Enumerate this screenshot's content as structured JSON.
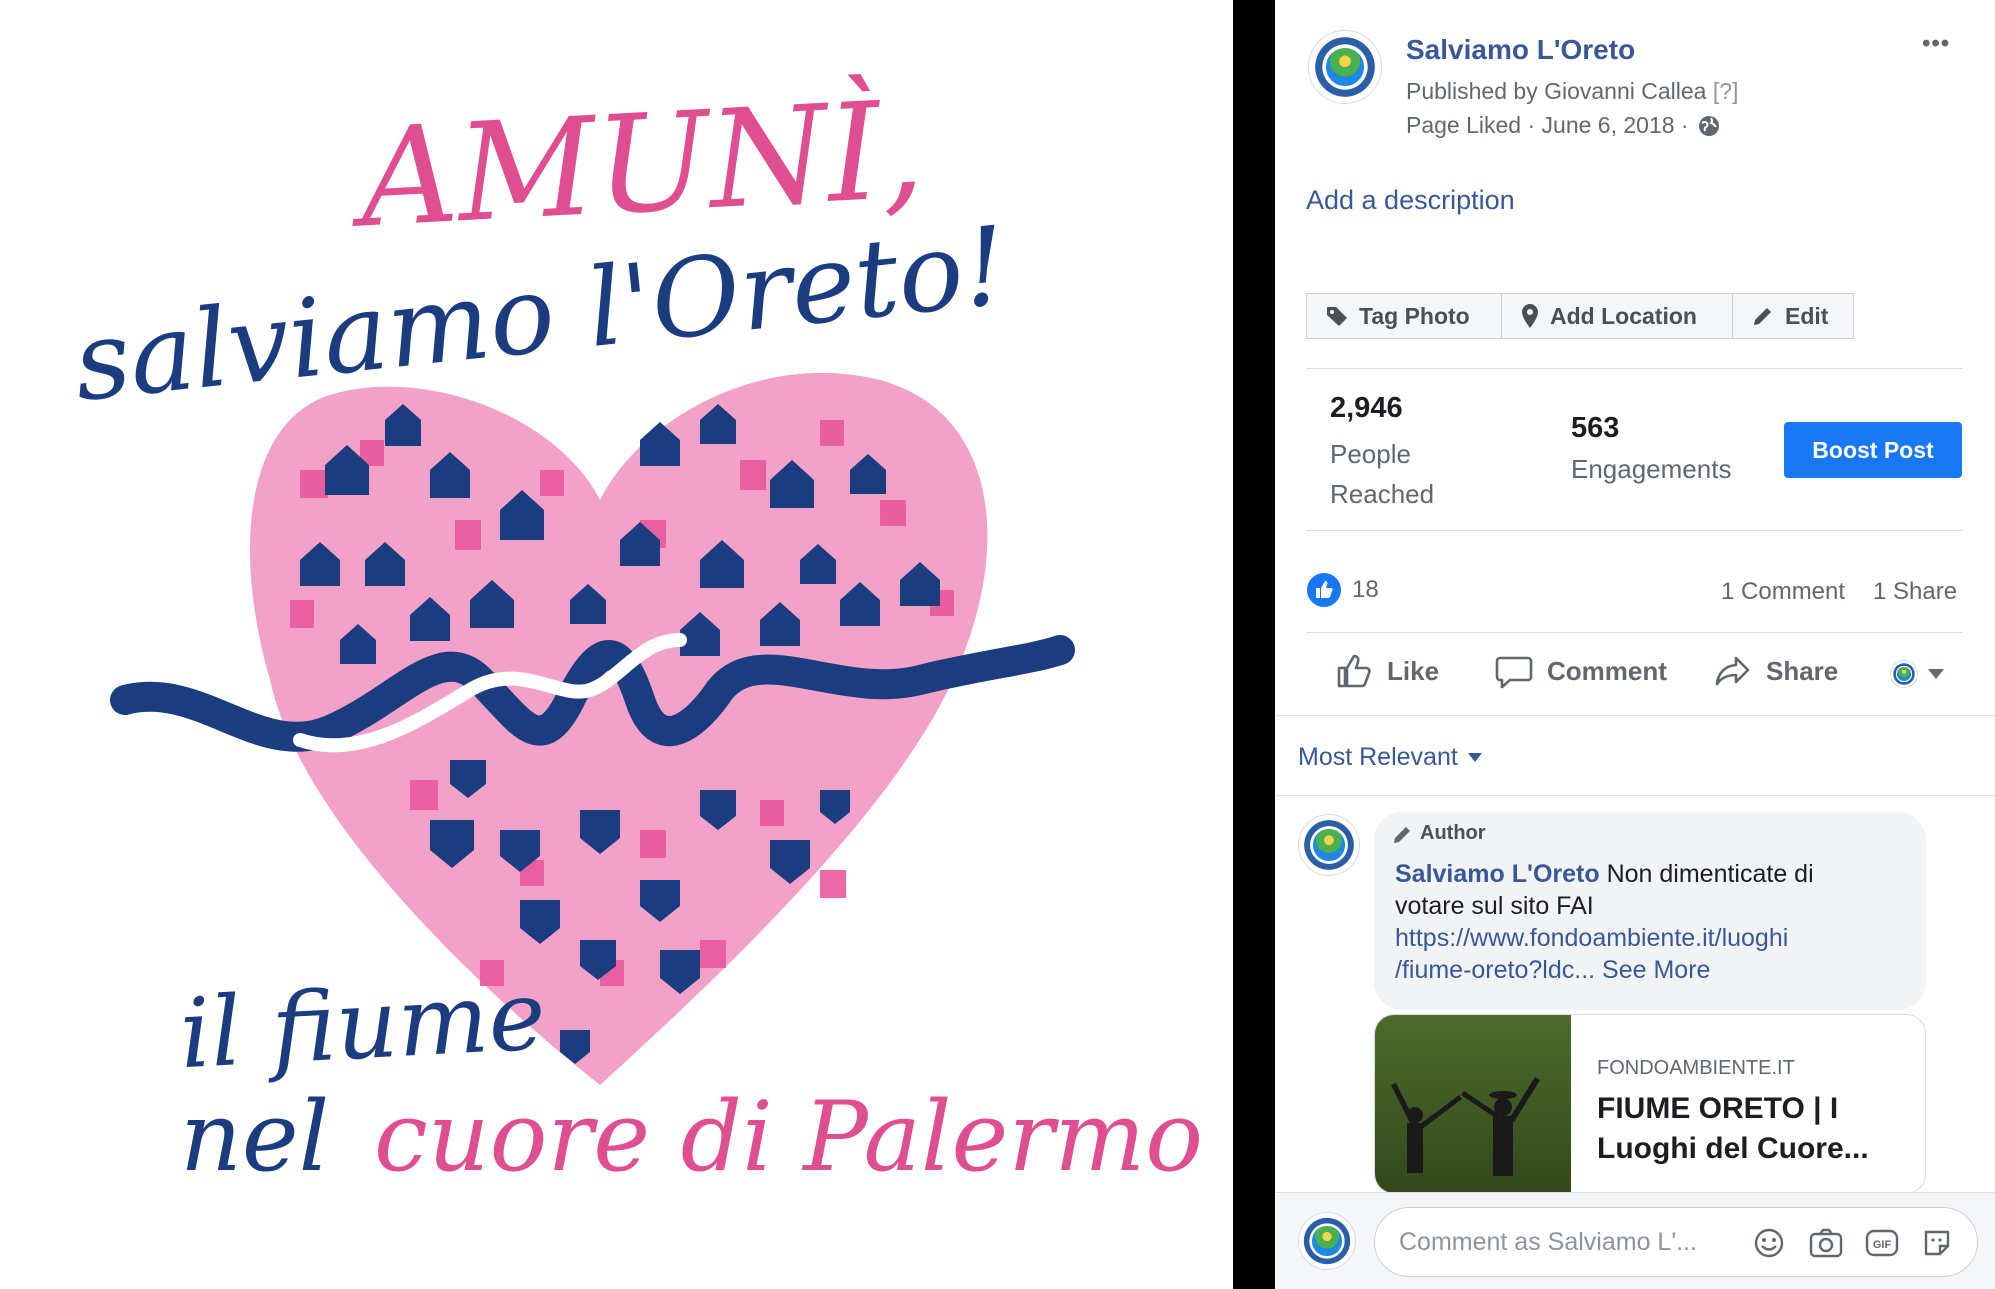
{
  "poster": {
    "line1": "AMUNÌ,",
    "line2": "salviamo l'Oreto!",
    "line3": "il fiume",
    "line4_blue": "nel",
    "line4_pink": "cuore di Palermo"
  },
  "post": {
    "page_name": "Salviamo L'Oreto",
    "published_by": "Published by Giovanni Callea",
    "help_mark": "[?]",
    "meta": "Page Liked · June 6, 2018 ·",
    "more_label": "•••",
    "add_description": "Add a description"
  },
  "toolbar": {
    "tag_photo": "Tag Photo",
    "add_location": "Add Location",
    "edit": "Edit"
  },
  "insights": {
    "reached_value": "2,946",
    "reached_label_1": "People",
    "reached_label_2": "Reached",
    "engagements_value": "563",
    "engagements_label": "Engagements",
    "boost_label": "Boost Post"
  },
  "reactions": {
    "like_count": "18",
    "comments": "1 Comment",
    "shares": "1 Share"
  },
  "actions": {
    "like": "Like",
    "comment": "Comment",
    "share": "Share"
  },
  "sort": {
    "label": "Most Relevant"
  },
  "comment": {
    "badge": "Author",
    "author": "Salviamo L'Oreto",
    "text_1": "Non dimenticate di",
    "text_2": "votare sul sito FAI",
    "url_1": "https://www.fondoambiente.it/luoghi",
    "url_2": "/fiume-oreto?ldc...",
    "see_more": "See More"
  },
  "link_preview": {
    "domain": "FONDOAMBIENTE.IT",
    "title_1": "FIUME ORETO | I",
    "title_2": "Luoghi del Cuore..."
  },
  "composer": {
    "placeholder": "Comment as Salviamo L'..."
  },
  "colors": {
    "brand_blue": "#1877f2",
    "link_blue": "#385898",
    "poster_pink": "#e04e92",
    "poster_navy": "#1b3d7f",
    "heart_pink": "#f2a1c8"
  },
  "icons": [
    "tag-icon",
    "location-pin-icon",
    "pencil-icon",
    "globe-icon",
    "like-reaction-icon",
    "thumbs-up-icon",
    "speech-bubble-icon",
    "share-arrow-icon",
    "caret-down-icon",
    "smiley-icon",
    "camera-icon",
    "gif-icon",
    "sticker-icon"
  ]
}
